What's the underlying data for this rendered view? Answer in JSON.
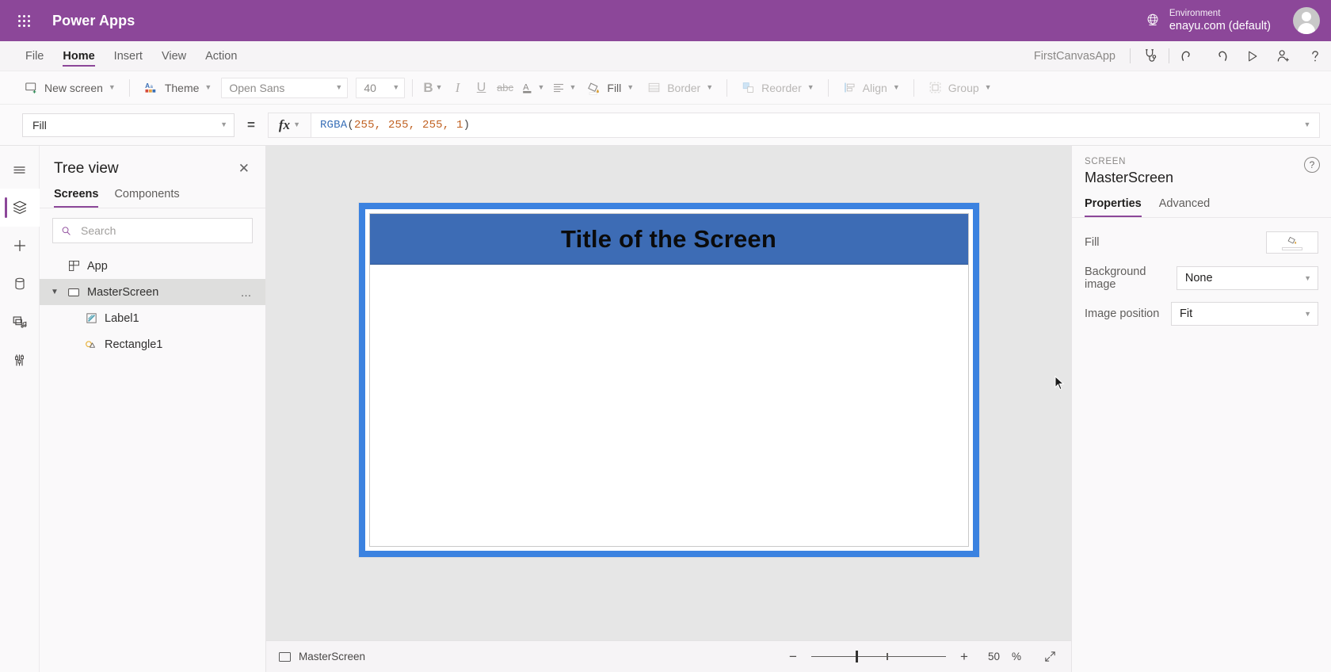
{
  "brandbar": {
    "waffle_tooltip": "App launcher",
    "product": "Power Apps",
    "environment_label": "Environment",
    "environment_value": "enayu.com (default)"
  },
  "menubar": {
    "items": [
      {
        "label": "File",
        "active": false
      },
      {
        "label": "Home",
        "active": true
      },
      {
        "label": "Insert",
        "active": false
      },
      {
        "label": "View",
        "active": false
      },
      {
        "label": "Action",
        "active": false
      }
    ],
    "app_name": "FirstCanvasApp",
    "icons": [
      {
        "name": "app-checker-icon"
      },
      {
        "name": "undo-icon"
      },
      {
        "name": "redo-icon"
      },
      {
        "name": "preview-icon"
      },
      {
        "name": "share-icon"
      },
      {
        "name": "help-icon"
      }
    ]
  },
  "ribbon": {
    "new_screen": "New screen",
    "theme": "Theme",
    "font_family": "Open Sans",
    "font_size": "40",
    "bold": "B",
    "italic": "I",
    "underline": "U",
    "strikethrough": "abc",
    "font_color": "A",
    "align": "align-icon",
    "fill": "Fill",
    "border": "Border",
    "reorder": "Reorder",
    "align_group": "Align",
    "group": "Group"
  },
  "formulabar": {
    "property": "Fill",
    "equals": "=",
    "fx": "fx",
    "formula_fn": "RGBA",
    "formula_open": "(",
    "formula_args": "255, 255, 255, 1",
    "formula_close": ")",
    "formula_full": "RGBA(255, 255, 255, 1)"
  },
  "rail": {
    "items": [
      {
        "name": "hamburger-icon",
        "label": "Menu",
        "active": false
      },
      {
        "name": "tree-view-icon",
        "label": "Tree view",
        "active": true
      },
      {
        "name": "insert-icon",
        "label": "Insert",
        "active": false
      },
      {
        "name": "data-icon",
        "label": "Data",
        "active": false
      },
      {
        "name": "media-icon",
        "label": "Media",
        "active": false
      },
      {
        "name": "advanced-tools-icon",
        "label": "Advanced tools",
        "active": false
      }
    ]
  },
  "treeview": {
    "title": "Tree view",
    "close": "✕",
    "tabs": [
      {
        "label": "Screens",
        "active": true
      },
      {
        "label": "Components",
        "active": false
      }
    ],
    "search_placeholder": "Search",
    "search_value": "",
    "nodes": [
      {
        "label": "App",
        "icon": "app-icon",
        "indent": 0,
        "selected": false,
        "expandable": false,
        "more": false
      },
      {
        "label": "MasterScreen",
        "icon": "screen-icon",
        "indent": 1,
        "selected": true,
        "expandable": true,
        "more": true
      },
      {
        "label": "Label1",
        "icon": "label-icon",
        "indent": 2,
        "selected": false,
        "expandable": false,
        "more": false
      },
      {
        "label": "Rectangle1",
        "icon": "shape-icon",
        "indent": 2,
        "selected": false,
        "expandable": false,
        "more": false
      }
    ]
  },
  "canvas": {
    "screen_title": "Title of the Screen",
    "selection_color": "#3b82e0",
    "banner_color": "#3d6cb5",
    "screen_background": "#ffffff",
    "statusbar": {
      "screen_name": "MasterScreen",
      "zoom_out": "−",
      "zoom_in": "+",
      "zoom_value": "50",
      "zoom_unit": "%",
      "fit_label": "fit-to-screen-icon"
    }
  },
  "properties": {
    "kind": "SCREEN",
    "name": "MasterScreen",
    "help": "?",
    "tabs": [
      {
        "label": "Properties",
        "active": true
      },
      {
        "label": "Advanced",
        "active": false
      }
    ],
    "rows": [
      {
        "label": "Fill",
        "control": "color",
        "value": "#ffffff"
      },
      {
        "label": "Background image",
        "control": "select",
        "value": "None"
      },
      {
        "label": "Image position",
        "control": "select",
        "value": "Fit"
      }
    ]
  }
}
